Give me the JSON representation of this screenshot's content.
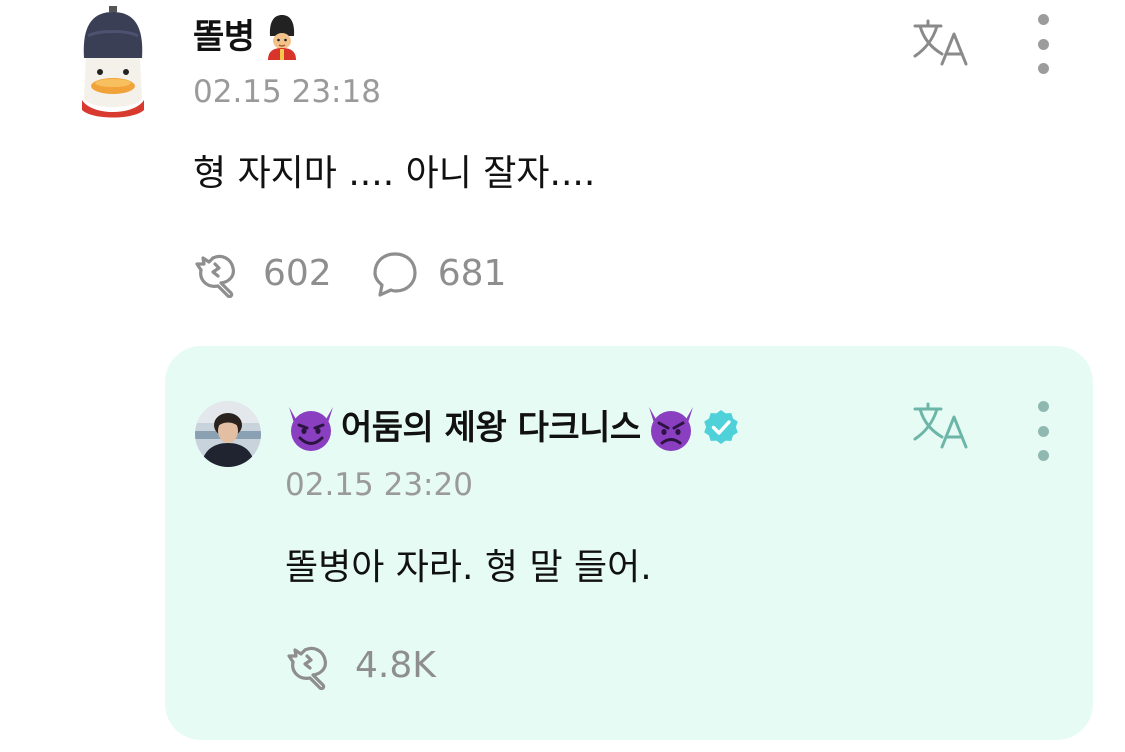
{
  "post": {
    "author": "똘병",
    "author_badge_icon": "royal-guard-emoji",
    "timestamp": "02.15 23:18",
    "text": "형 자지마 .... 아니 잘자....",
    "likes": "602",
    "comments": "681"
  },
  "reply": {
    "author": "어둠의 제왕 다크니스",
    "author_prefix_icon": "smiling-devil-emoji",
    "author_suffix_icon": "angry-devil-emoji",
    "verified_icon": "verified-check-icon",
    "timestamp": "02.15 23:20",
    "text": "똘병아 자라. 형 말 들어.",
    "likes": "4.8K"
  },
  "colors": {
    "reply_background": "#e7fbf5",
    "muted_text": "#9a9a9a",
    "translate_icon": "#8a8a8a",
    "translate_icon_reply": "#6cb6a8",
    "verified": "#4fd1d9",
    "devil_purple": "#8a3fc0"
  }
}
